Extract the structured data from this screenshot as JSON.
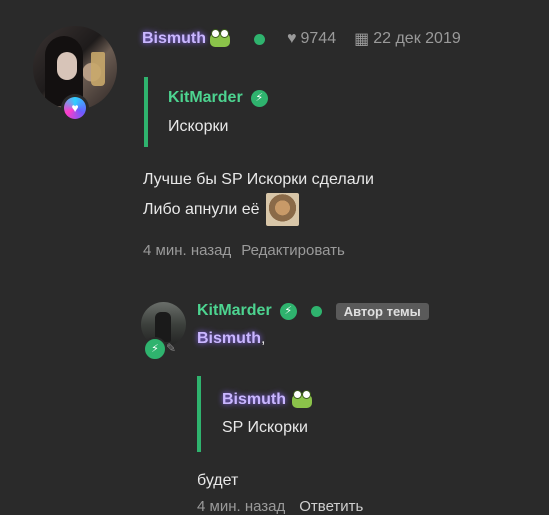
{
  "post": {
    "author": "Bismuth",
    "likes": "9744",
    "date": "22 дек 2019",
    "quote": {
      "author": "KitMarder",
      "text": "Искорки"
    },
    "lines": [
      "Лучше бы SP Искорки сделали",
      "Либо апнули её"
    ],
    "time": "4 мин. назад",
    "edit_label": "Редактировать"
  },
  "reply": {
    "author": "KitMarder",
    "author_badge": "Автор темы",
    "mention": "Bismuth",
    "mention_suffix": ",",
    "quote": {
      "author": "Bismuth",
      "text": "SP Искорки"
    },
    "text": "будет",
    "time": "4 мин. назад",
    "reply_label": "Ответить"
  },
  "colors": {
    "accent_green": "#2fb36e",
    "nick_purple": "#c9b6ff",
    "background": "#2a2a2a"
  },
  "icons": [
    "heart-icon",
    "calendar-icon",
    "bolt-icon",
    "frog-emoji-icon",
    "pencil-icon"
  ]
}
